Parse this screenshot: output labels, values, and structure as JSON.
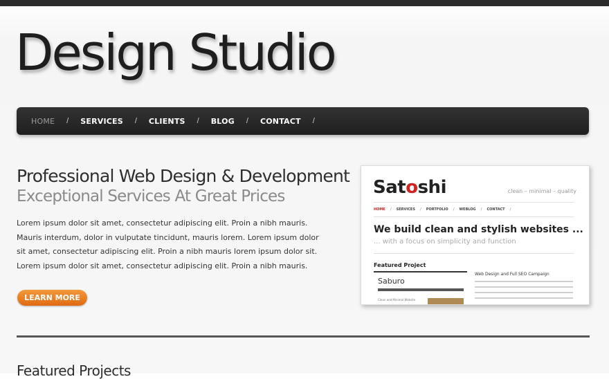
{
  "logo": "Design Studio",
  "nav": {
    "items": [
      {
        "label": "HOME",
        "active": true
      },
      {
        "label": "SERVICES",
        "active": false
      },
      {
        "label": "CLIENTS",
        "active": false
      },
      {
        "label": "BLOG",
        "active": false
      },
      {
        "label": "CONTACT",
        "active": false
      }
    ],
    "separator": "/"
  },
  "hero": {
    "headline": "Professional Web Design & Development",
    "subheadline": "Exceptional Services At Great Prices",
    "body": "Lorem ipsum dolor sit amet, consectetur adipiscing elit. Proin a nibh mauris. Mauris interdum, dolor in vulputate tincidunt, mauris lorem. Lorem ipsum dolor sit amet, consectetur adipiscing elit. Proin a nibh mauris lorem ipsum dolor sit. Lorem ipsum dolor sit amet, consectetur adipiscing elit. Proin a nibh mauris.",
    "cta_label": "LEARN MORE"
  },
  "thumbnail": {
    "logo_before": "Sat",
    "logo_red": "o",
    "logo_after": "shi",
    "tagline": "clean – minimal – quality",
    "nav": [
      "HOME",
      "SERVICES",
      "PORTFOLIO",
      "WEBLOG",
      "CONTACT"
    ],
    "headline": "We build clean and stylish websites ...",
    "subheadline": "... with a focus on simplicity and function",
    "featured_label": "Featured Project",
    "project_name": "Saburo",
    "project_caption": "Clean and Minimal Website",
    "project_title": "Web Design and Full SEO Campaign"
  },
  "section": {
    "title": "Featured Projects"
  },
  "colors": {
    "accent": "#e8801f",
    "nav_bg": "#2a2a2a",
    "brand_red": "#d22222"
  }
}
